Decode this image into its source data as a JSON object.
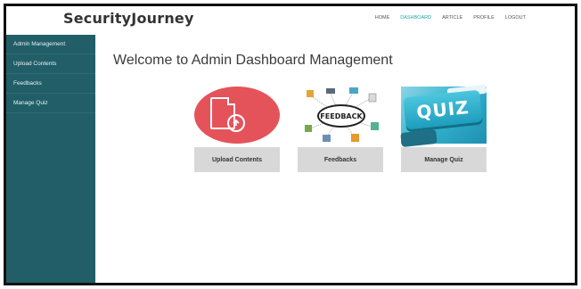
{
  "brand": "SecurityJourney",
  "nav": {
    "items": [
      "HOME",
      "DASHBOARD",
      "ARTICLE",
      "PROFILE",
      "LOGOUT"
    ],
    "active": "DASHBOARD"
  },
  "sidebar": {
    "items": [
      {
        "label": "Admin Management"
      },
      {
        "label": "Upload Contents"
      },
      {
        "label": "Feedbacks"
      },
      {
        "label": "Manage Quiz"
      }
    ]
  },
  "main": {
    "title": "Welcome to Admin Dashboard Management",
    "cards": [
      {
        "button_label": "Upload Contents",
        "icon": "upload-file-icon"
      },
      {
        "button_label": "Feedbacks",
        "icon": "feedback-illustration"
      },
      {
        "button_label": "Manage Quiz",
        "icon": "quiz-keyboard-image"
      }
    ],
    "feedback_text": "FEEDBACK",
    "quiz_text": "QUIZ"
  },
  "colors": {
    "sidebar_bg": "#215e67",
    "active_nav": "#1aa6a6",
    "upload_red": "#e5535a",
    "button_gray": "#d8d8d8"
  }
}
